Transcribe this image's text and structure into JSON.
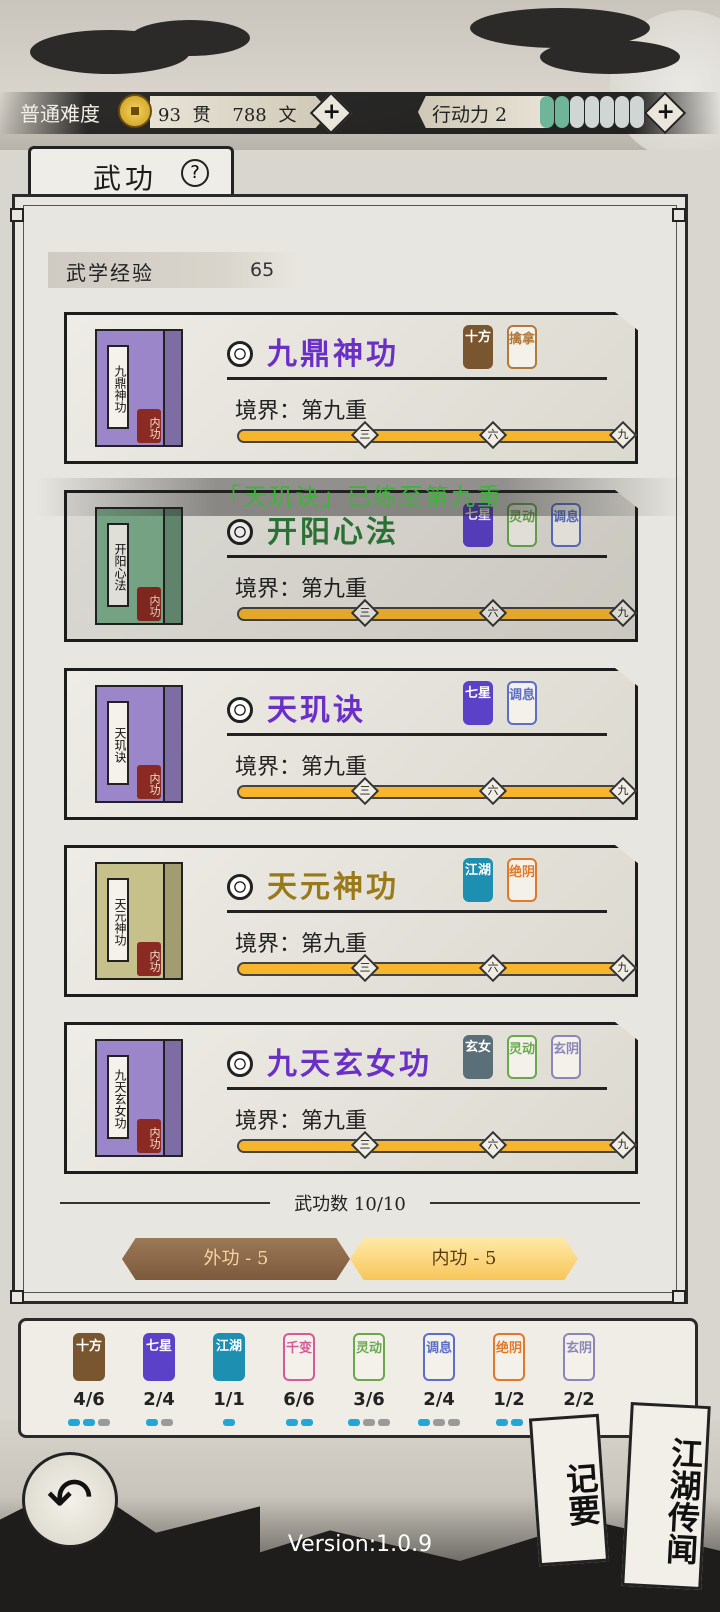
{
  "colors": {
    "purple": "#6a2fc6",
    "green": "#2f7a3a",
    "gold": "#9a7a18",
    "progress": "#f2a623",
    "toast": "#3fb43c"
  },
  "hud": {
    "difficulty": "普通难度",
    "guan_value": "93",
    "guan_unit": "贯",
    "wen_value": "788",
    "wen_unit": "文",
    "energy_label": "行动力 2",
    "energy_total": 7,
    "energy_filled": 2,
    "plus_glyph": "+"
  },
  "tab": {
    "title": "武功",
    "help_glyph": "?"
  },
  "experience": {
    "label": "武学经验",
    "value": "65"
  },
  "toast": "「天玑诀」已练至第九重",
  "skills": [
    {
      "name": "九鼎神功",
      "book_title": "九鼎神功",
      "seal": "内功",
      "realm": "境界：第九重",
      "progress": 1.0,
      "marks": [
        "三",
        "六",
        "九"
      ],
      "color": "#6a2fc6",
      "book_color": "#9a86c8",
      "tags": [
        {
          "text": "十方",
          "style": "solid",
          "color": "#7a5630"
        },
        {
          "text": "擒拿",
          "style": "outline",
          "color": "#b07a3a"
        }
      ]
    },
    {
      "name": "开阳心法",
      "book_title": "开阳心法",
      "seal": "内功",
      "realm": "境界：第九重",
      "progress": 1.0,
      "marks": [
        "三",
        "六",
        "九"
      ],
      "color": "#2f7a3a",
      "book_color": "#7fb08e",
      "tags": [
        {
          "text": "七星",
          "style": "solid",
          "color": "#5b40c8"
        },
        {
          "text": "灵动",
          "style": "outline",
          "color": "#6aa84f"
        },
        {
          "text": "调息",
          "style": "outline",
          "color": "#5b6fc8"
        }
      ]
    },
    {
      "name": "天玑诀",
      "book_title": "天玑诀",
      "seal": "内功",
      "realm": "境界：第九重",
      "progress": 1.0,
      "marks": [
        "三",
        "六",
        "九"
      ],
      "color": "#6a2fc6",
      "book_color": "#9a86c8",
      "tags": [
        {
          "text": "七星",
          "style": "solid",
          "color": "#5b40c8"
        },
        {
          "text": "调息",
          "style": "outline",
          "color": "#5b6fc8"
        }
      ]
    },
    {
      "name": "天元神功",
      "book_title": "天元神功",
      "seal": "内功",
      "realm": "境界：第九重",
      "progress": 1.0,
      "marks": [
        "三",
        "六",
        "九"
      ],
      "color": "#9a7a18",
      "book_color": "#c6c08a",
      "tags": [
        {
          "text": "江湖",
          "style": "solid",
          "color": "#1d8fb0"
        },
        {
          "text": "绝阴",
          "style": "outline",
          "color": "#e07a2a"
        }
      ]
    },
    {
      "name": "九天玄女功",
      "book_title": "九天玄女功",
      "seal": "内功",
      "realm": "境界：第九重",
      "progress": 1.0,
      "marks": [
        "三",
        "六",
        "九"
      ],
      "color": "#6a2fc6",
      "book_color": "#9a86c8",
      "tags": [
        {
          "text": "玄女",
          "style": "solid",
          "color": "#5a6f78"
        },
        {
          "text": "灵动",
          "style": "outline",
          "color": "#6aa84f"
        },
        {
          "text": "玄阴",
          "style": "outline",
          "color": "#8a86b8"
        }
      ]
    }
  ],
  "skill_count": "武功数 10/10",
  "filters": {
    "outer": "外功 - 5",
    "inner": "内功 - 5"
  },
  "traits": [
    {
      "name": "十方",
      "count": "4/6",
      "style": "solid",
      "color": "#7a5630",
      "dots": [
        true,
        true,
        false
      ]
    },
    {
      "name": "七星",
      "count": "2/4",
      "style": "solid",
      "color": "#5b40c8",
      "dots": [
        true,
        false
      ]
    },
    {
      "name": "江湖",
      "count": "1/1",
      "style": "solid",
      "color": "#1d8fb0",
      "dots": [
        true
      ]
    },
    {
      "name": "千变",
      "count": "6/6",
      "style": "outline",
      "color": "#d45a9a",
      "dots": [
        true,
        true
      ]
    },
    {
      "name": "灵动",
      "count": "3/6",
      "style": "outline",
      "color": "#6aa84f",
      "dots": [
        true,
        false,
        false
      ]
    },
    {
      "name": "调息",
      "count": "2/4",
      "style": "outline",
      "color": "#5b6fc8",
      "dots": [
        true,
        false,
        false
      ]
    },
    {
      "name": "绝阴",
      "count": "1/2",
      "style": "outline",
      "color": "#e07a2a",
      "dots": [
        true,
        true
      ]
    },
    {
      "name": "玄阴",
      "count": "2/2",
      "style": "outline",
      "color": "#8a86b8",
      "dots": [
        true
      ]
    }
  ],
  "nav": {
    "back_glyph": "↶",
    "notes": "记要",
    "legends": "江湖传闻"
  },
  "version": "Version:1.0.9"
}
